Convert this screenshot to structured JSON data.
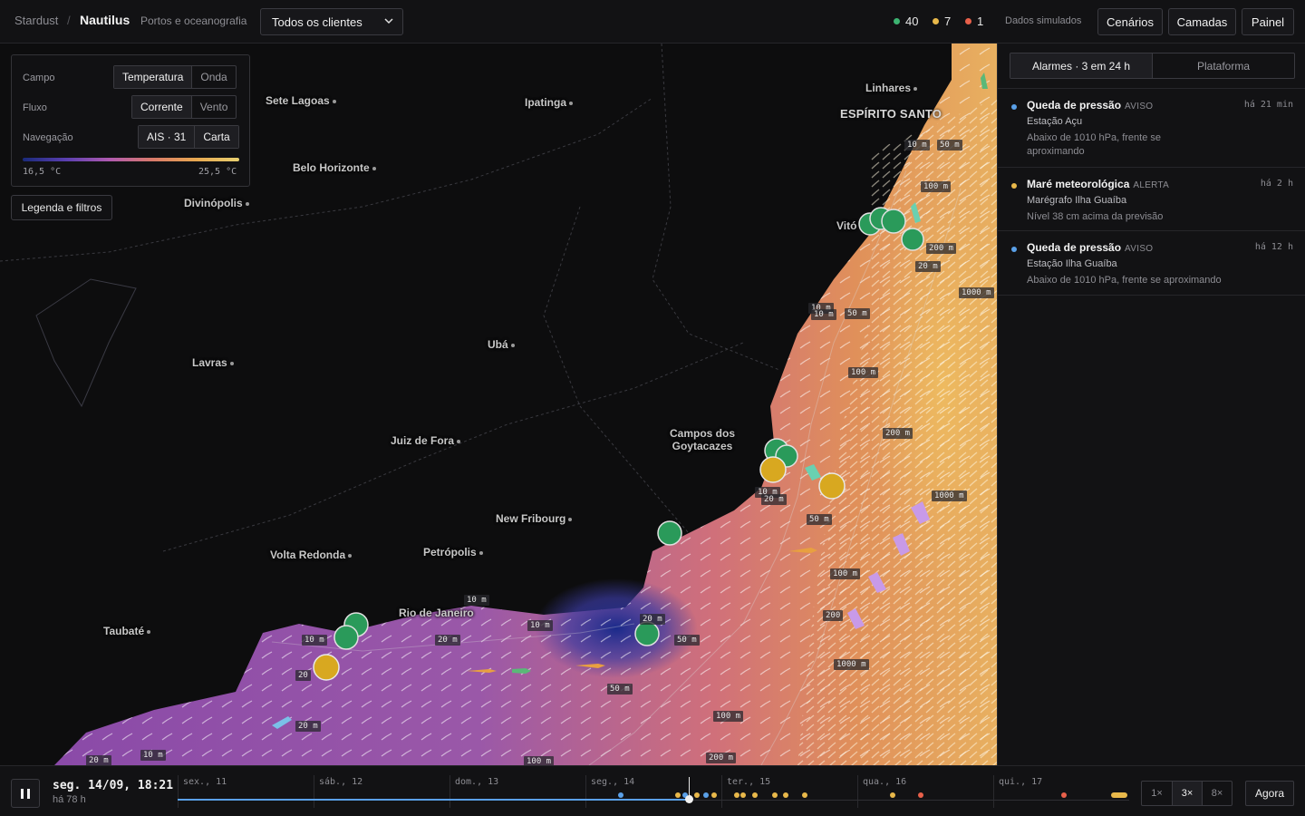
{
  "header": {
    "brand": "Stardust",
    "separator": "/",
    "app_name": "Nautilus",
    "app_subtitle": "Portos e oceanografia",
    "client_select": "Todos os clientes",
    "status_counts": [
      {
        "value": "40",
        "color": "#3cb371"
      },
      {
        "value": "7",
        "color": "#e8b84a"
      },
      {
        "value": "1",
        "color": "#e8604a"
      }
    ],
    "sim_label": "Dados simulados",
    "buttons": {
      "scenarios": "Cenários",
      "layers": "Camadas",
      "dashboard": "Painel"
    }
  },
  "map": {
    "controls": {
      "field_label": "Campo",
      "field_options": [
        "Temperatura",
        "Onda"
      ],
      "flow_label": "Fluxo",
      "flow_options": [
        "Corrente",
        "Vento"
      ],
      "nav_label": "Navegação",
      "nav_options": [
        "AIS · 31",
        "Carta"
      ],
      "scale_min": "16,5 °C",
      "scale_max": "25,5 °C"
    },
    "legend_button": "Legenda e filtros",
    "states": [
      "ESPÍRITO SANTO"
    ],
    "cities": [
      "Sete Lagoas",
      "Ipatinga",
      "Linhares",
      "Belo Horizonte",
      "Divinópolis",
      "Vitó",
      "Ubá",
      "Lavras",
      "Campos dos Goytacazes",
      "Juiz de Fora",
      "New Fribourg",
      "Volta Redonda",
      "Petrópolis",
      "Rio de Janeiro",
      "Taubaté"
    ],
    "depth_labels": [
      "10 m",
      "50 m",
      "100 m",
      "200 m",
      "20 m",
      "1000 m",
      "10 m",
      "50 m",
      "100 m",
      "200 m",
      "1000 m",
      "10 m",
      "20 m",
      "50 m",
      "100 m",
      "200",
      "1000 m",
      "10 m",
      "20 m",
      "10 m",
      "50 m",
      "10 m",
      "20 m",
      "20",
      "50 m",
      "100 m",
      "200 m",
      "100 m",
      "10 m",
      "20 m",
      "20 m",
      "10 m"
    ]
  },
  "alarms": {
    "tabs": [
      "Alarmes · 3 em 24 h",
      "Plataforma"
    ],
    "items": [
      {
        "title": "Queda de pressão",
        "level": "AVISO",
        "time": "há 21 min",
        "station": "Estação Açu",
        "desc": "Abaixo de 1010 hPa, frente se aproximando",
        "color": "#5aa0e8"
      },
      {
        "title": "Maré meteorológica",
        "level": "ALERTA",
        "time": "há 2 h",
        "station": "Marégrafo Ilha Guaíba",
        "desc": "Nível 38 cm acima da previsão",
        "color": "#e8b84a"
      },
      {
        "title": "Queda de pressão",
        "level": "AVISO",
        "time": "há 12 h",
        "station": "Estação Ilha Guaíba",
        "desc": "Abaixo de 1010 hPa, frente se aproximando",
        "color": "#5aa0e8"
      }
    ]
  },
  "timeline": {
    "current": "seg. 14/09, 18:21",
    "ago": "há 78 h",
    "days": [
      "sex., 11",
      "sáb., 12",
      "dom., 13",
      "seg., 14",
      "ter., 15",
      "qua., 16",
      "qui., 17"
    ],
    "speeds": [
      "1×",
      "3×",
      "8×"
    ],
    "now_button": "Agora"
  }
}
